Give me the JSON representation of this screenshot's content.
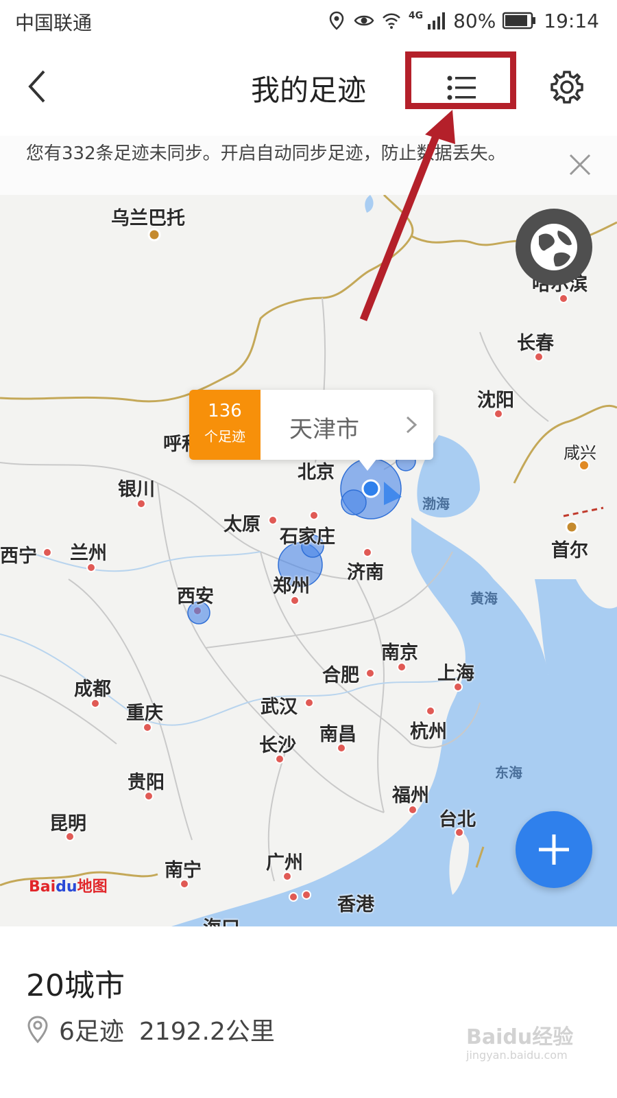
{
  "status_bar": {
    "carrier": "中国联通",
    "network": "4G",
    "battery": "80%",
    "time": "19:14"
  },
  "nav": {
    "title": "我的足迹",
    "icons": [
      "back-icon",
      "list-icon",
      "gear-icon"
    ]
  },
  "banner": {
    "text": "您有332条足迹未同步。开启自动同步足迹，防止数据丢失。"
  },
  "popup": {
    "count": "136",
    "unit": "个足迹",
    "city": "天津市"
  },
  "map": {
    "cities": [
      "乌兰巴托",
      "哈尔滨",
      "长春",
      "沈阳",
      "咸兴",
      "呼和",
      "北京",
      "银川",
      "太原",
      "石家庄",
      "西宁",
      "兰州",
      "济南",
      "首尔",
      "郑州",
      "西安",
      "南京",
      "上海",
      "合肥",
      "成都",
      "武汉",
      "重庆",
      "杭州",
      "南昌",
      "长沙",
      "贵阳",
      "福州",
      "台北",
      "昆明",
      "南宁",
      "广州",
      "香港",
      "海口"
    ],
    "seas": [
      "渤海",
      "黄海",
      "东海"
    ],
    "logo": {
      "brand": "Bai",
      "du": "du",
      "suffix": "地图"
    }
  },
  "summary": {
    "cities": "20城市",
    "footprints": "6足迹",
    "distance": "2192.2公里"
  },
  "watermark": {
    "text": "Baidu经验",
    "url": "jingyan.baidu.com"
  },
  "colors": {
    "accent": "#2f80ec",
    "badge": "#f7900a",
    "annotation": "#b4202a"
  }
}
